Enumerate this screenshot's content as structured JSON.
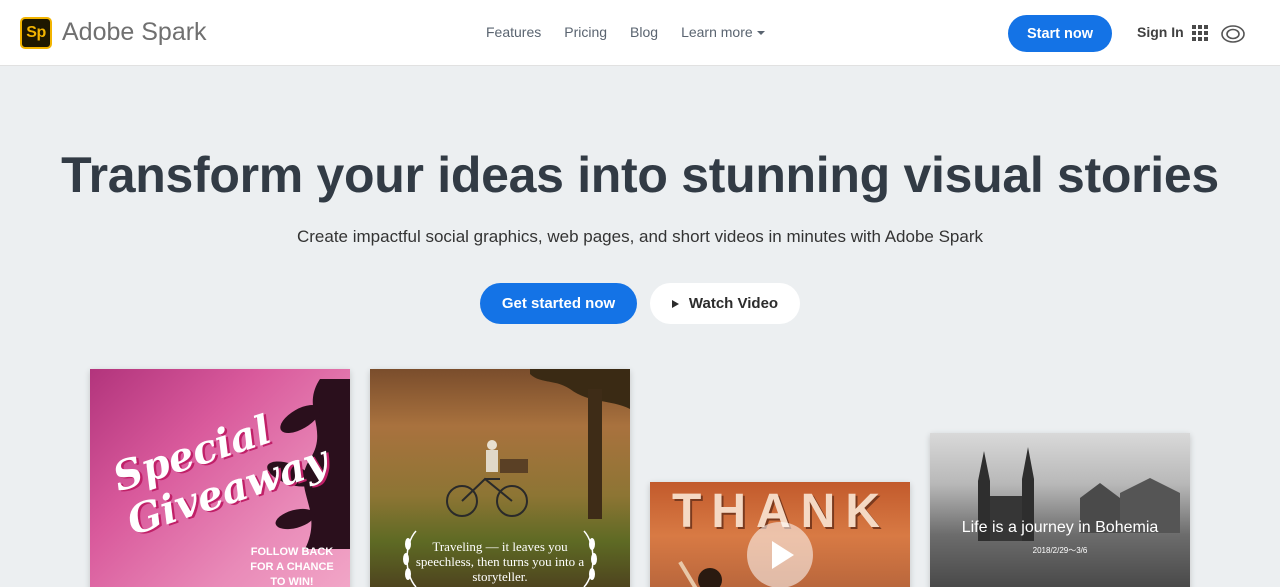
{
  "header": {
    "logo_text": "Sp",
    "brand": "Adobe Spark",
    "nav": [
      {
        "label": "Features"
      },
      {
        "label": "Pricing"
      },
      {
        "label": "Blog"
      },
      {
        "label": "Learn more"
      }
    ],
    "start_button": "Start now",
    "sign_in": "Sign In",
    "apps_icon": "apps-grid-icon",
    "cc_icon": "creative-cloud-icon"
  },
  "hero": {
    "headline": "Transform your ideas into stunning visual stories",
    "subhead": "Create impactful social graphics, web pages, and short videos in minutes with Adobe Spark",
    "get_started": "Get started now",
    "watch_video": "Watch Video"
  },
  "cards": {
    "giveaway": {
      "title": "Special Giveaway",
      "caption": "FOLLOW BACK FOR A CHANCE TO WIN!"
    },
    "traveling": {
      "quote": "Traveling — it leaves you speechless, then turns you into a storyteller."
    },
    "thank": {
      "title": "THANK"
    },
    "bohemia": {
      "title": "Life is a journey in Bohemia",
      "date": "2018/2/29〜3/6"
    }
  },
  "colors": {
    "accent": "#1473e6",
    "headline": "#323b45",
    "background": "#eceff1"
  }
}
